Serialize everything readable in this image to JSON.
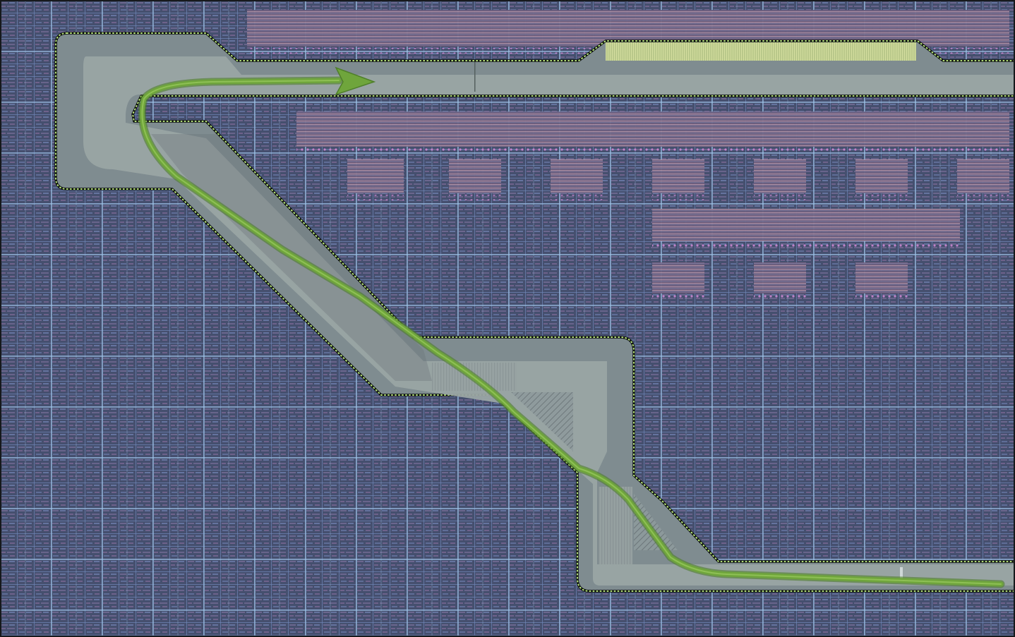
{
  "colors": {
    "background": "#3a4464",
    "cell_fill": "#454f6e",
    "grid_minor": "#6f86b8",
    "grid_major": "#9fc3e6",
    "cell_detail": "#8b7aa8",
    "dense_block": "#6a5a78",
    "dense_line": "#c4a4b6",
    "dot_accent": "#d48ad8",
    "channel_outer": "#7f8c90",
    "channel_inner": "#9aa5a4",
    "channel_hatch": "#6a7478",
    "channel_outline": "#0b0f0c",
    "channel_dots": "#b6e37a",
    "path_green": "#6fa53c",
    "path_highlight": "#9bcc5f",
    "bus_yellow": "#c6d48e",
    "frame": "#16191c"
  },
  "diagram": {
    "kind": "chip-layout",
    "route": {
      "style": "curved-arrow",
      "direction": "left-to-right"
    }
  }
}
